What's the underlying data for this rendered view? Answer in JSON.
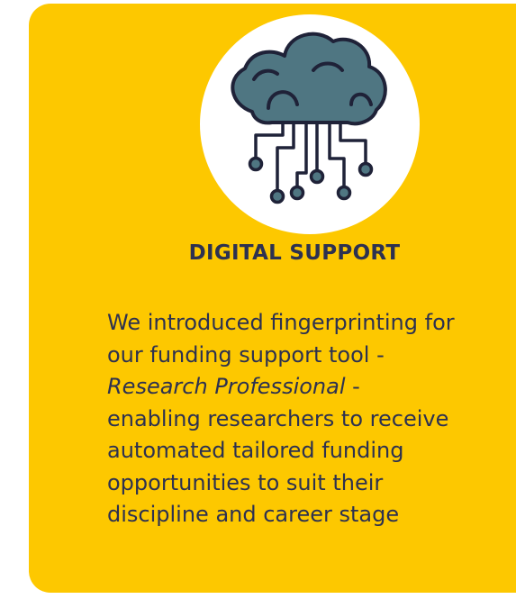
{
  "card": {
    "title": "DIGITAL SUPPORT",
    "icon": "cloud-circuit-icon",
    "body_lines": [
      "We introduced fingerprinting for",
      "our funding support tool -",
      "enabling researchers to receive",
      "automated tailored funding",
      "opportunities to suit their",
      "discipline and career stage"
    ],
    "tool_name": "Research Professional",
    "tool_suffix": " -"
  },
  "colors": {
    "card_background": "#fdc800",
    "text": "#2d3150",
    "cloud_fill": "#4f7682",
    "outline": "#1f2238"
  }
}
